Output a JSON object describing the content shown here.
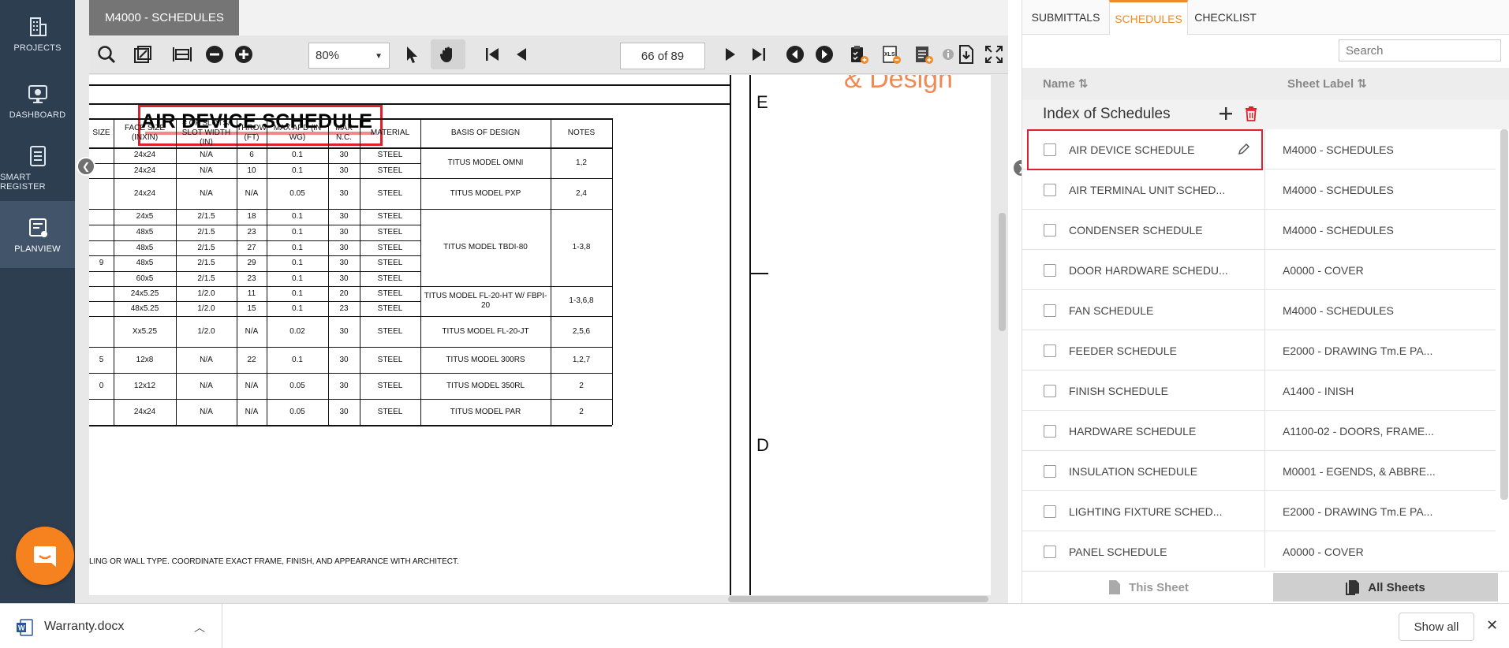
{
  "nav": [
    {
      "label": "PROJECTS",
      "icon": "building-icon"
    },
    {
      "label": "DASHBOARD",
      "icon": "dashboard-icon"
    },
    {
      "label": "SMART REGISTER",
      "icon": "register-icon"
    },
    {
      "label": "PLANVIEW",
      "icon": "planview-icon",
      "active": true
    }
  ],
  "viewer": {
    "doc_tab": "M4000 - SCHEDULES",
    "zoom": "80%",
    "page": "66 of 89"
  },
  "drawing": {
    "title": "AIR DEVICE SCHEDULE",
    "headers": [
      "SIZE",
      "FACE SIZE (INXIN)",
      "# OF SLOTS/ SLOT WIDTH (IN)",
      "THROW (FT)",
      "MAX APD (IN WG)",
      "MAX N.C.",
      "MATERIAL",
      "BASIS OF DESIGN",
      "NOTES"
    ],
    "rows": [
      {
        "size": "",
        "face": "24x24",
        "slots": "N/A",
        "throw": "6",
        "apd": "0.1",
        "nc": "30",
        "mat": "STEEL"
      },
      {
        "size": "",
        "face": "24x24",
        "slots": "N/A",
        "throw": "10",
        "apd": "0.1",
        "nc": "30",
        "mat": "STEEL"
      },
      {
        "size": "",
        "face": "24x24",
        "slots": "N/A",
        "throw": "N/A",
        "apd": "0.05",
        "nc": "30",
        "mat": "STEEL"
      },
      {
        "size": "",
        "face": "24x5",
        "slots": "2/1.5",
        "throw": "18",
        "apd": "0.1",
        "nc": "30",
        "mat": "STEEL"
      },
      {
        "size": "",
        "face": "48x5",
        "slots": "2/1.5",
        "throw": "23",
        "apd": "0.1",
        "nc": "30",
        "mat": "STEEL"
      },
      {
        "size": "",
        "face": "48x5",
        "slots": "2/1.5",
        "throw": "27",
        "apd": "0.1",
        "nc": "30",
        "mat": "STEEL"
      },
      {
        "size": "9",
        "face": "48x5",
        "slots": "2/1.5",
        "throw": "29",
        "apd": "0.1",
        "nc": "30",
        "mat": "STEEL"
      },
      {
        "size": "",
        "face": "60x5",
        "slots": "2/1.5",
        "throw": "23",
        "apd": "0.1",
        "nc": "30",
        "mat": "STEEL"
      },
      {
        "size": "",
        "face": "24x5.25",
        "slots": "1/2.0",
        "throw": "11",
        "apd": "0.1",
        "nc": "20",
        "mat": "STEEL"
      },
      {
        "size": "",
        "face": "48x5.25",
        "slots": "1/2.0",
        "throw": "15",
        "apd": "0.1",
        "nc": "23",
        "mat": "STEEL"
      },
      {
        "size": "",
        "face": "Xx5.25",
        "slots": "1/2.0",
        "throw": "N/A",
        "apd": "0.02",
        "nc": "30",
        "mat": "STEEL"
      },
      {
        "size": "5",
        "face": "12x8",
        "slots": "N/A",
        "throw": "22",
        "apd": "0.1",
        "nc": "30",
        "mat": "STEEL"
      },
      {
        "size": "0",
        "face": "12x12",
        "slots": "N/A",
        "throw": "N/A",
        "apd": "0.05",
        "nc": "30",
        "mat": "STEEL"
      },
      {
        "size": "",
        "face": "24x24",
        "slots": "N/A",
        "throw": "N/A",
        "apd": "0.05",
        "nc": "30",
        "mat": "STEEL"
      }
    ],
    "groups": [
      {
        "basis": "TITUS MODEL OMNI",
        "notes": "1,2"
      },
      {
        "basis": "TITUS MODEL PXP",
        "notes": "2,4"
      },
      {
        "basis": "TITUS MODEL TBDI-80",
        "notes": "1-3,8"
      },
      {
        "basis": "TITUS MODEL FL-20-HT W/ FBPI-20",
        "notes": "1-3,6,8"
      },
      {
        "basis": "TITUS MODEL FL-20-JT",
        "notes": "2,5,6"
      },
      {
        "basis": "TITUS MODEL 300RS",
        "notes": "1,2,7"
      },
      {
        "basis": "TITUS MODEL 350RL",
        "notes": "2"
      },
      {
        "basis": "TITUS MODEL PAR",
        "notes": "2"
      }
    ],
    "footnote": "LING OR WALL TYPE. COORDINATE EXACT FRAME, FINISH, AND APPEARANCE WITH ARCHITECT.",
    "grid_letters": [
      "E",
      "D"
    ],
    "logo_fragment": "& Design"
  },
  "panel": {
    "tabs": [
      "SUBMITTALS",
      "SCHEDULES",
      "CHECKLIST"
    ],
    "active_tab": "SCHEDULES",
    "search_placeholder": "Search",
    "col_name": "Name ⇅",
    "col_label": "Sheet Label ⇅",
    "index_title": "Index of Schedules",
    "items": [
      {
        "name": "AIR DEVICE SCHEDULE",
        "label": "M4000 - SCHEDULES"
      },
      {
        "name": "AIR TERMINAL UNIT SCHED...",
        "label": "M4000 - SCHEDULES"
      },
      {
        "name": "CONDENSER SCHEDULE",
        "label": "M4000 - SCHEDULES"
      },
      {
        "name": "DOOR HARDWARE SCHEDU...",
        "label": "A0000 - COVER"
      },
      {
        "name": "FAN SCHEDULE",
        "label": "M4000 - SCHEDULES"
      },
      {
        "name": "FEEDER SCHEDULE",
        "label": "E2000 - DRAWING Tm.E PA..."
      },
      {
        "name": "FINISH SCHEDULE",
        "label": "A1400 - INISH"
      },
      {
        "name": "HARDWARE SCHEDULE",
        "label": "A1100-02 - DOORS, FRAME..."
      },
      {
        "name": "INSULATION SCHEDULE",
        "label": "M0001 - EGENDS, & ABBRE..."
      },
      {
        "name": "LIGHTING FIXTURE SCHED...",
        "label": "E2000 - DRAWING Tm.E PA..."
      },
      {
        "name": "PANEL SCHEDULE",
        "label": "A0000 - COVER"
      }
    ],
    "this_sheet": "This Sheet",
    "all_sheets": "All Sheets"
  },
  "download": {
    "file": "Warranty.docx",
    "show_all": "Show all"
  },
  "colors": {
    "nav_bg": "#2d3e50",
    "accent": "#f08a24",
    "highlight": "#e0202b",
    "chat": "#f5821f"
  }
}
